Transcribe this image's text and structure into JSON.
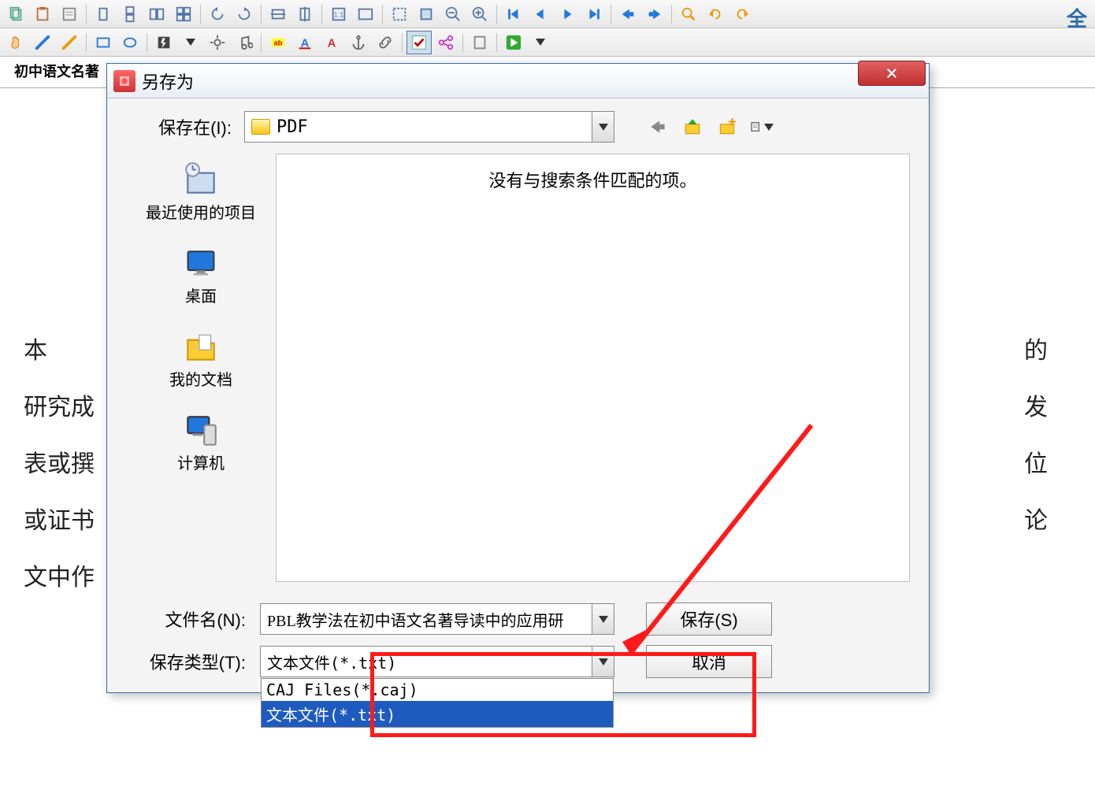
{
  "toolbar_right_label": "全",
  "tab_title": "初中语文名著",
  "doc_lines": [
    "本",
    "研究成",
    "表或撰",
    "或证书",
    "文中作"
  ],
  "doc_lines_right": [
    "的",
    "发",
    "位",
    "论",
    ""
  ],
  "dialog": {
    "title": "另存为",
    "save_in_label": "保存在(I):",
    "save_in_value": "PDF",
    "empty_message": "没有与搜索条件匹配的项。",
    "sidebar": [
      {
        "label": "最近使用的项目"
      },
      {
        "label": "桌面"
      },
      {
        "label": "我的文档"
      },
      {
        "label": "计算机"
      }
    ],
    "filename_label": "文件名(N):",
    "filename_value": "PBL教学法在初中语文名著导读中的应用研",
    "filetype_label": "保存类型(T):",
    "filetype_value": "文本文件(*.txt)",
    "filetype_options": [
      "CAJ Files(*.caj)",
      "文本文件(*.txt)"
    ],
    "save_button": "保存(S)",
    "cancel_button": "取消"
  }
}
